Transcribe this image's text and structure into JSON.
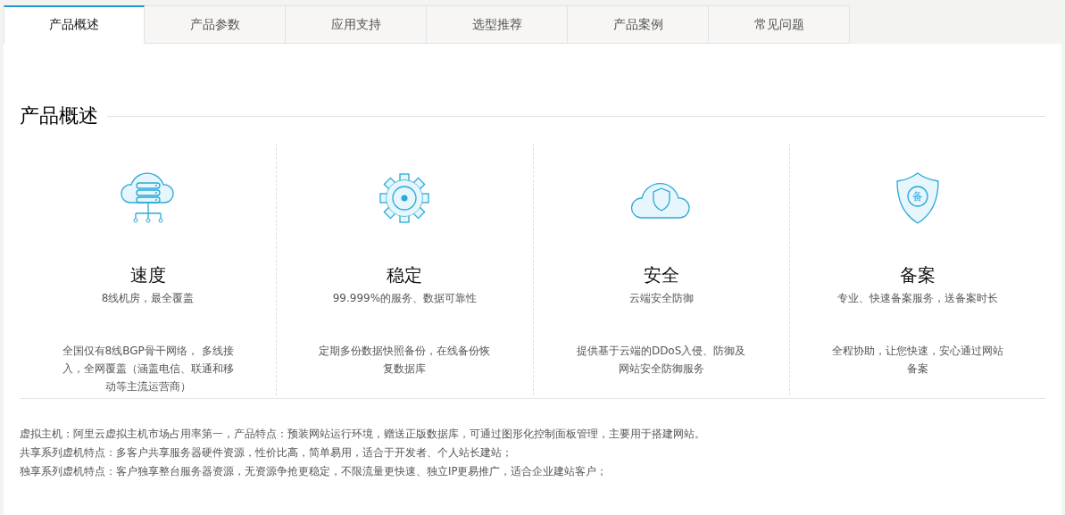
{
  "tabs": [
    {
      "label": "产品概述",
      "selected": true
    },
    {
      "label": "产品参数",
      "selected": false
    },
    {
      "label": "应用支持",
      "selected": false
    },
    {
      "label": "选型推荐",
      "selected": false
    },
    {
      "label": "产品案例",
      "selected": false
    },
    {
      "label": "常见问题",
      "selected": false
    }
  ],
  "section": {
    "title": "产品概述"
  },
  "features": [
    {
      "kind": "server-cloud",
      "title": "速度",
      "subtitle": "8线机房，最全覆盖",
      "description": "全国仅有8线BGP骨干网络， 多线接入，全网覆盖（涵盖电信、联通和移动等主流运营商）"
    },
    {
      "kind": "gear",
      "title": "稳定",
      "subtitle": "99.999%的服务、数据可靠性",
      "description": "定期多份数据快照备份，在线备份恢复数据库"
    },
    {
      "kind": "cloud-shield",
      "title": "安全",
      "subtitle": "云端安全防御",
      "description": "提供基于云端的DDoS入侵、防御及网站安全防御服务"
    },
    {
      "kind": "shield-badge",
      "badge_text": "备",
      "title": "备案",
      "subtitle": "专业、快速备案服务，送备案时长",
      "description": "全程协助，让您快速，安心通过网站备案"
    }
  ],
  "notes": [
    "虚拟主机：阿里云虚拟主机市场占用率第一，产品特点：预装网站运行环境，赠送正版数据库，可通过图形化控制面板管理，主要用于搭建网站。",
    "共享系列虚机特点：多客户共享服务器硬件资源，性价比高，简单易用，适合于开发者、个人站长建站；",
    "独享系列虚机特点：客户独享整台服务器资源，无资源争抢更稳定，不限流量更快速、独立IP更易推广，适合企业建站客户；"
  ]
}
